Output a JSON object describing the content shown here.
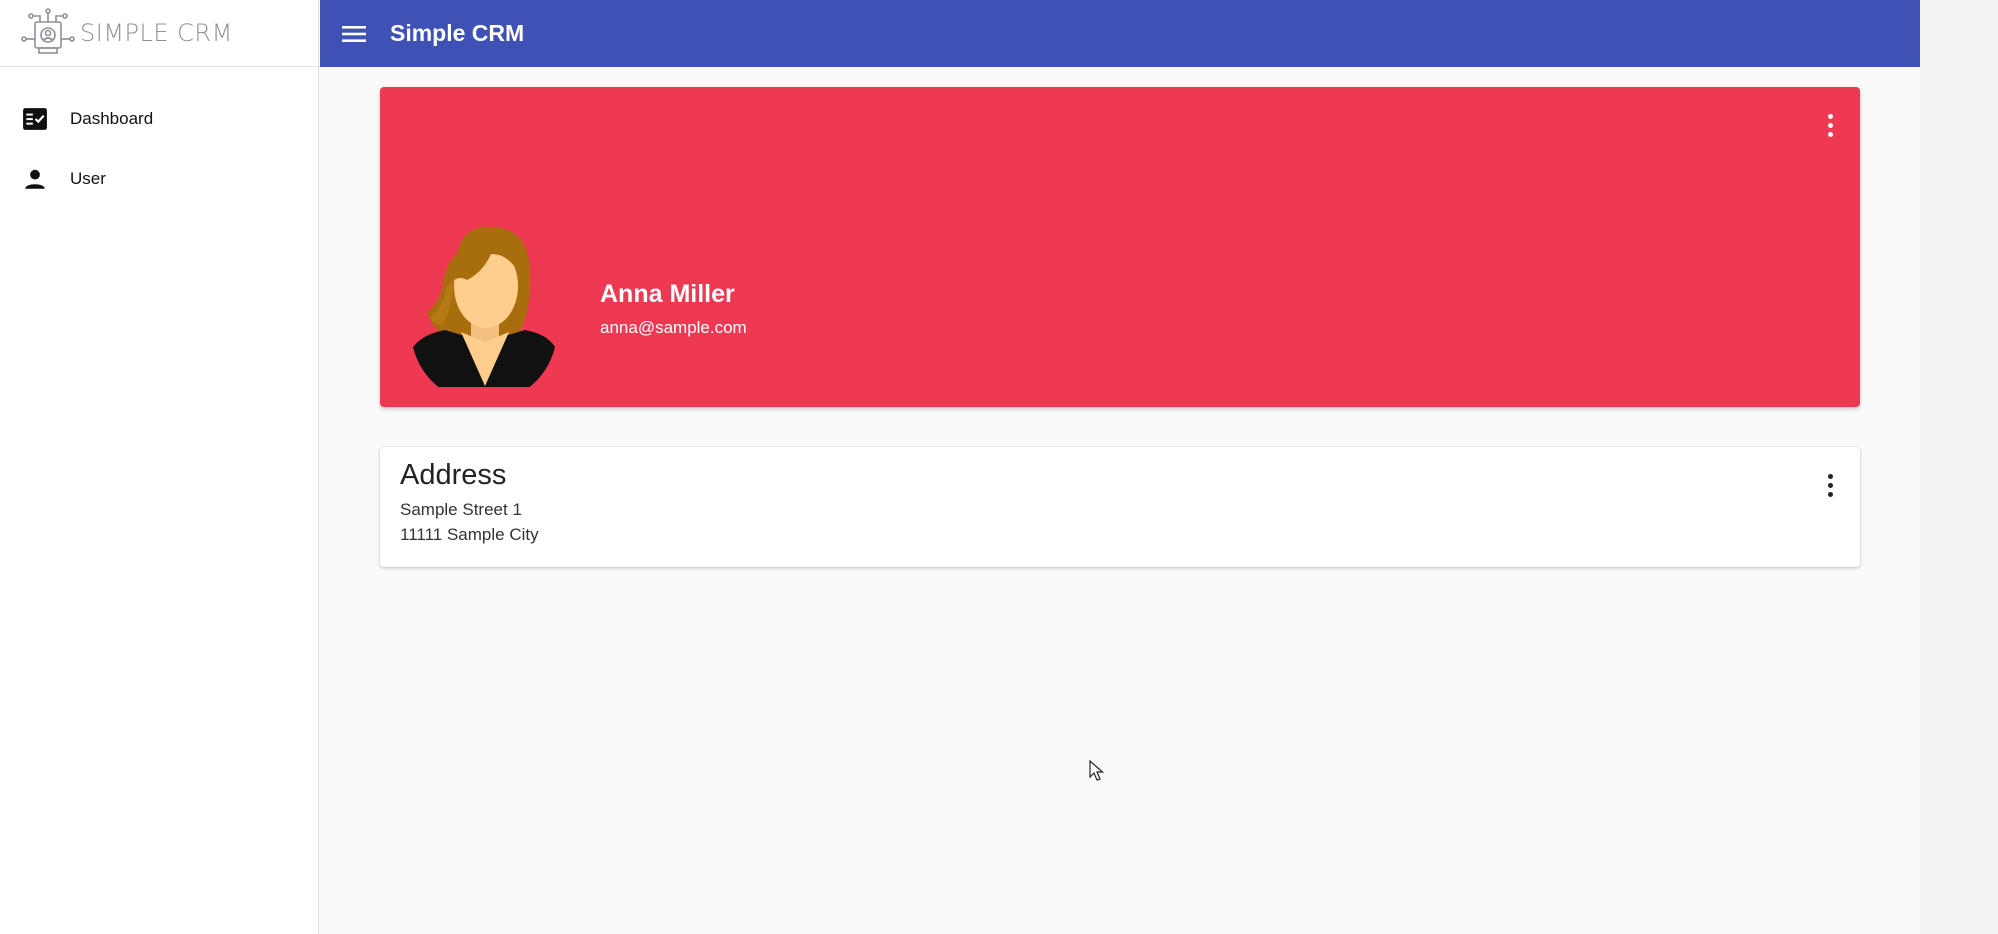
{
  "sidebar": {
    "logo_text": "SIMPLE CRM",
    "items": [
      {
        "label": "Dashboard",
        "icon": "checklist-icon"
      },
      {
        "label": "User",
        "icon": "person-icon"
      }
    ]
  },
  "header": {
    "title": "Simple CRM",
    "menu_icon": "hamburger-menu-icon"
  },
  "profile": {
    "name": "Anna Miller",
    "email": "anna@sample.com",
    "more_icon": "more-vertical-icon"
  },
  "address": {
    "title": "Address",
    "line1": "Sample Street 1",
    "line2": "11111 Sample City",
    "more_icon": "more-vertical-icon"
  },
  "colors": {
    "primary": "#3f51b5",
    "profile_card": "#ef3953",
    "logo_text": "#8d9099"
  }
}
